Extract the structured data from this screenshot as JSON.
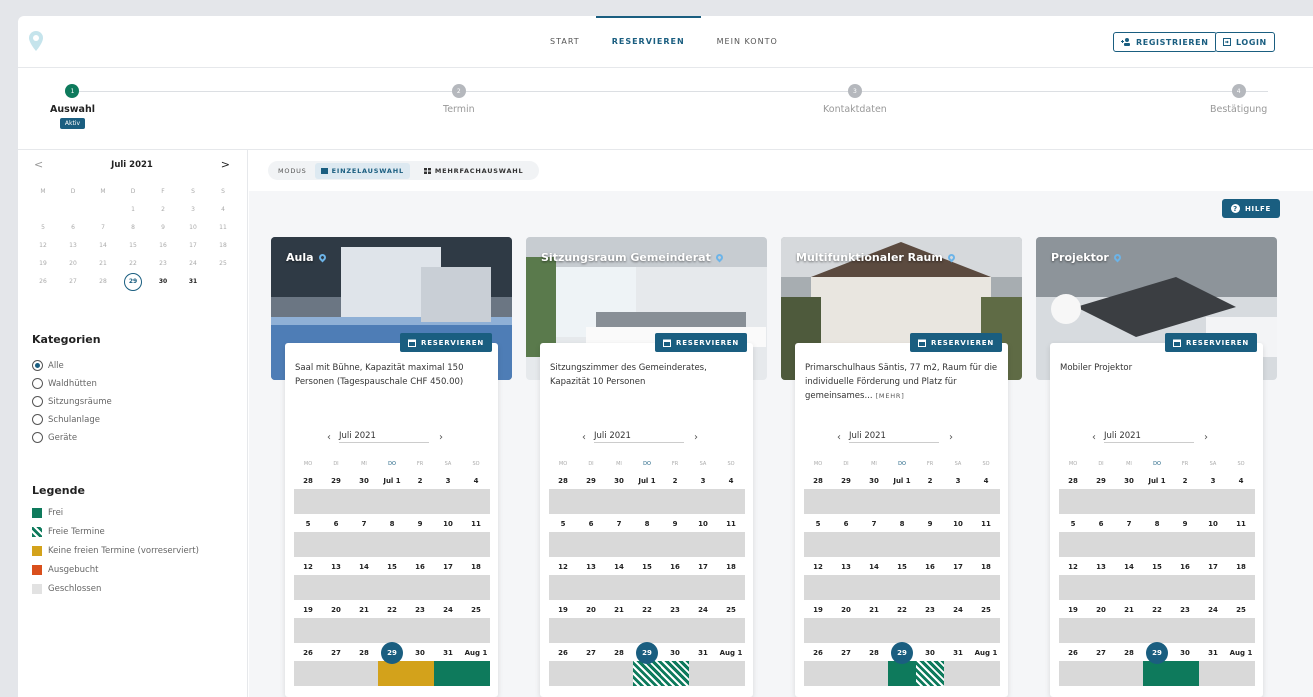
{
  "nav": {
    "start": "START",
    "reservieren": "RESERVIEREN",
    "mein_konto": "MEIN KONTO"
  },
  "auth": {
    "register": "REGISTRIEREN",
    "login": "LOGIN"
  },
  "steps": [
    {
      "num": "1",
      "label": "Auswahl",
      "badge": "Aktiv"
    },
    {
      "num": "2",
      "label": "Termin"
    },
    {
      "num": "3",
      "label": "Kontaktdaten"
    },
    {
      "num": "4",
      "label": "Bestätigung"
    }
  ],
  "mini_calendar": {
    "title": "Juli 2021",
    "prev": "<",
    "next": ">",
    "weekdays": [
      "M",
      "D",
      "M",
      "D",
      "F",
      "S",
      "S"
    ],
    "days": [
      "",
      "",
      "",
      "1",
      "2",
      "3",
      "4",
      "5",
      "6",
      "7",
      "8",
      "9",
      "10",
      "11",
      "12",
      "13",
      "14",
      "15",
      "16",
      "17",
      "18",
      "19",
      "20",
      "21",
      "22",
      "23",
      "24",
      "25",
      "26",
      "27",
      "28",
      "29",
      "30",
      "31",
      ""
    ],
    "today": "29"
  },
  "categories": {
    "title": "Kategorien",
    "selected": "Alle",
    "items": [
      "Alle",
      "Waldhütten",
      "Sitzungsräume",
      "Schulanlage",
      "Geräte"
    ]
  },
  "legend": {
    "title": "Legende",
    "items": [
      {
        "label": "Frei",
        "color": "#0e7a5c"
      },
      {
        "label": "Freie Termine",
        "color": "#0e7a5c"
      },
      {
        "label": "Keine freien Termine (vorreserviert)",
        "color": "#d3a21b"
      },
      {
        "label": "Ausgebucht",
        "color": "#d94f1c"
      },
      {
        "label": "Geschlossen",
        "color": "#d9d9d9"
      }
    ]
  },
  "mode": {
    "label": "MODUS",
    "single": "EINZELAUSWAHL",
    "multi": "MEHRFACHAUSWAHL"
  },
  "help": "HILFE",
  "reserve_label": "RESERVIEREN",
  "resources": [
    {
      "name": "Aula",
      "desc": "Saal mit Bühne, Kapazität maximal 150 Personen (Tagespauschale CHF 450.00)",
      "month": "Juli 2021",
      "more": ""
    },
    {
      "name": "Sitzungsraum Gemeinderat",
      "desc": "Sitzungszimmer des Gemeinderates, Kapazität 10 Personen",
      "month": "Juli 2021",
      "more": ""
    },
    {
      "name": "Multifunktionaler Raum",
      "desc": "Primarschulhaus Säntis, 77 m2, Raum für die individuelle Förderung und Platz für gemeinsames...",
      "month": "Juli 2021",
      "more": "[MEHR]"
    },
    {
      "name": "Projektor",
      "desc": "Mobiler Projektor",
      "month": "Juli 2021",
      "more": ""
    }
  ],
  "cal_weekdays": [
    "MO",
    "DI",
    "MI",
    "DO",
    "FR",
    "SA",
    "SO"
  ],
  "cal_weeks": [
    [
      "28",
      "29",
      "30",
      "Jul 1",
      "2",
      "3",
      "4"
    ],
    [
      "5",
      "6",
      "7",
      "8",
      "9",
      "10",
      "11"
    ],
    [
      "12",
      "13",
      "14",
      "15",
      "16",
      "17",
      "18"
    ],
    [
      "19",
      "20",
      "21",
      "22",
      "23",
      "24",
      "25"
    ],
    [
      "26",
      "27",
      "28",
      "29",
      "30",
      "31",
      "Aug 1"
    ]
  ],
  "last_week_status": [
    [
      "closed",
      "closed",
      "closed",
      "reserved",
      "reserved",
      "free",
      "free"
    ],
    [
      "closed",
      "closed",
      "closed",
      "partial",
      "partial",
      "closed",
      "closed"
    ],
    [
      "closed",
      "closed",
      "closed",
      "free",
      "partial",
      "closed",
      "closed"
    ],
    [
      "closed",
      "closed",
      "closed",
      "free",
      "free",
      "closed",
      "closed"
    ]
  ]
}
